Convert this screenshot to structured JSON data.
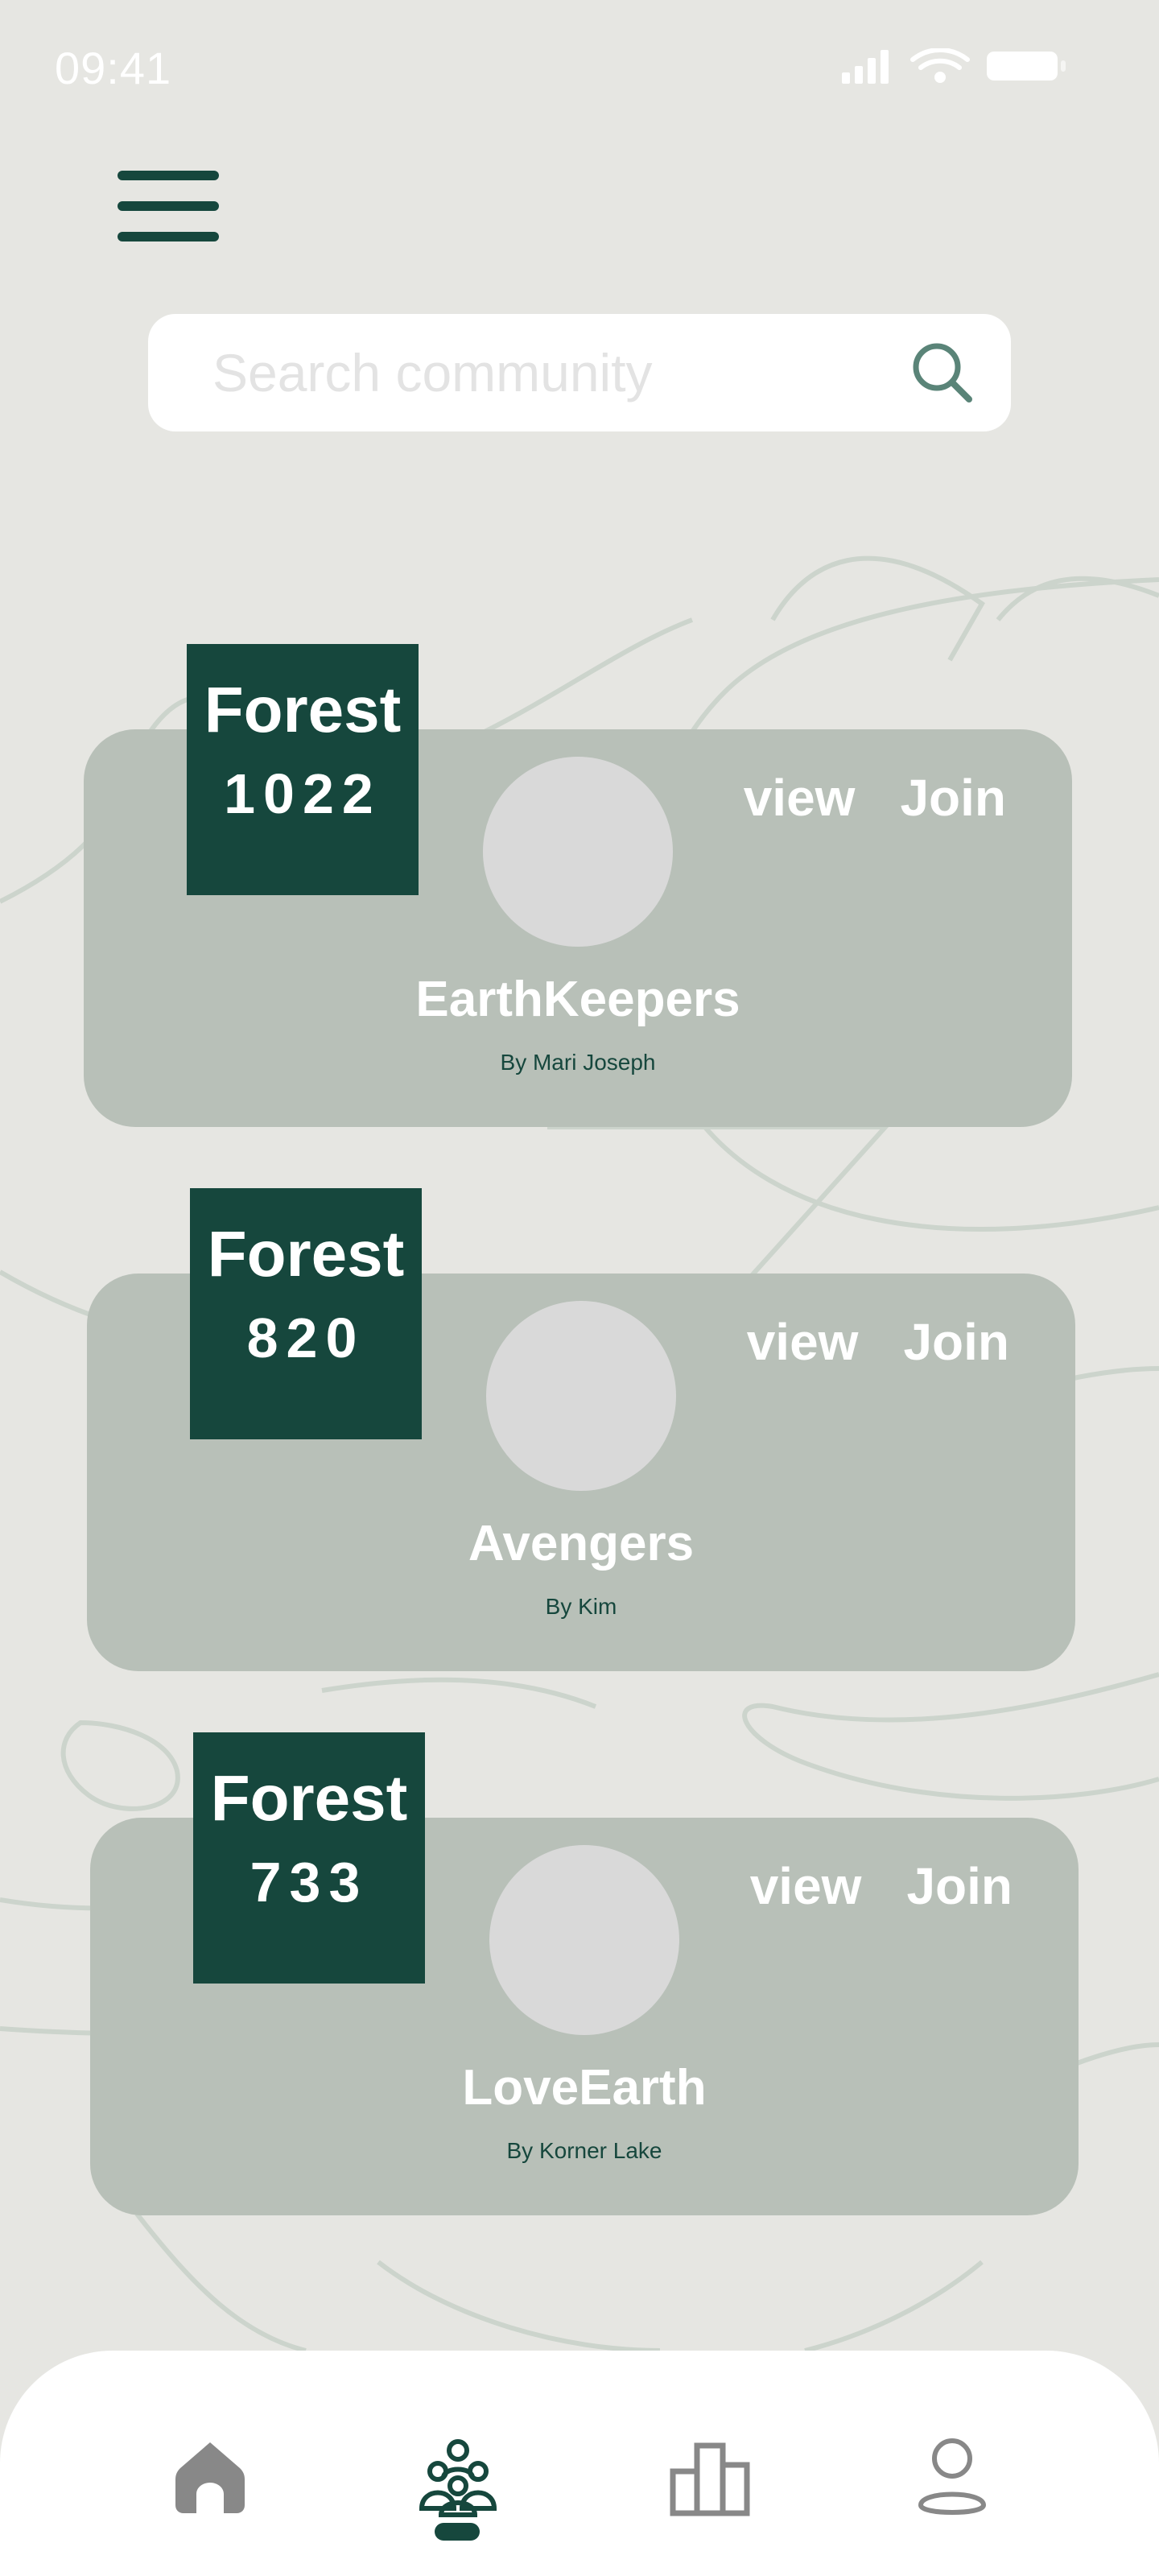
{
  "status_bar": {
    "time": "09:41"
  },
  "search": {
    "placeholder": "Search community",
    "value": ""
  },
  "communities": [
    {
      "tag": "Forest",
      "count": "1022",
      "name": "EarthKeepers",
      "author": "By Mari Joseph",
      "view_label": "view",
      "join_label": "Join"
    },
    {
      "tag": "Forest",
      "count": "820",
      "name": "Avengers",
      "author": "By Kim",
      "view_label": "view",
      "join_label": "Join"
    },
    {
      "tag": "Forest",
      "count": "733",
      "name": "LoveEarth",
      "author": "By Korner Lake",
      "view_label": "view",
      "join_label": "Join"
    }
  ],
  "bottom_nav": {
    "items": [
      {
        "icon": "home-icon",
        "active": false
      },
      {
        "icon": "community-icon",
        "active": true
      },
      {
        "icon": "leaderboard-icon",
        "active": false
      },
      {
        "icon": "profile-icon",
        "active": false
      }
    ]
  },
  "colors": {
    "background": "#e6e6e2",
    "card": "#b8c0b8",
    "brand_dark_green": "#16473d",
    "avatar_placeholder": "#d9d9d9",
    "nav_inactive": "#888888"
  }
}
